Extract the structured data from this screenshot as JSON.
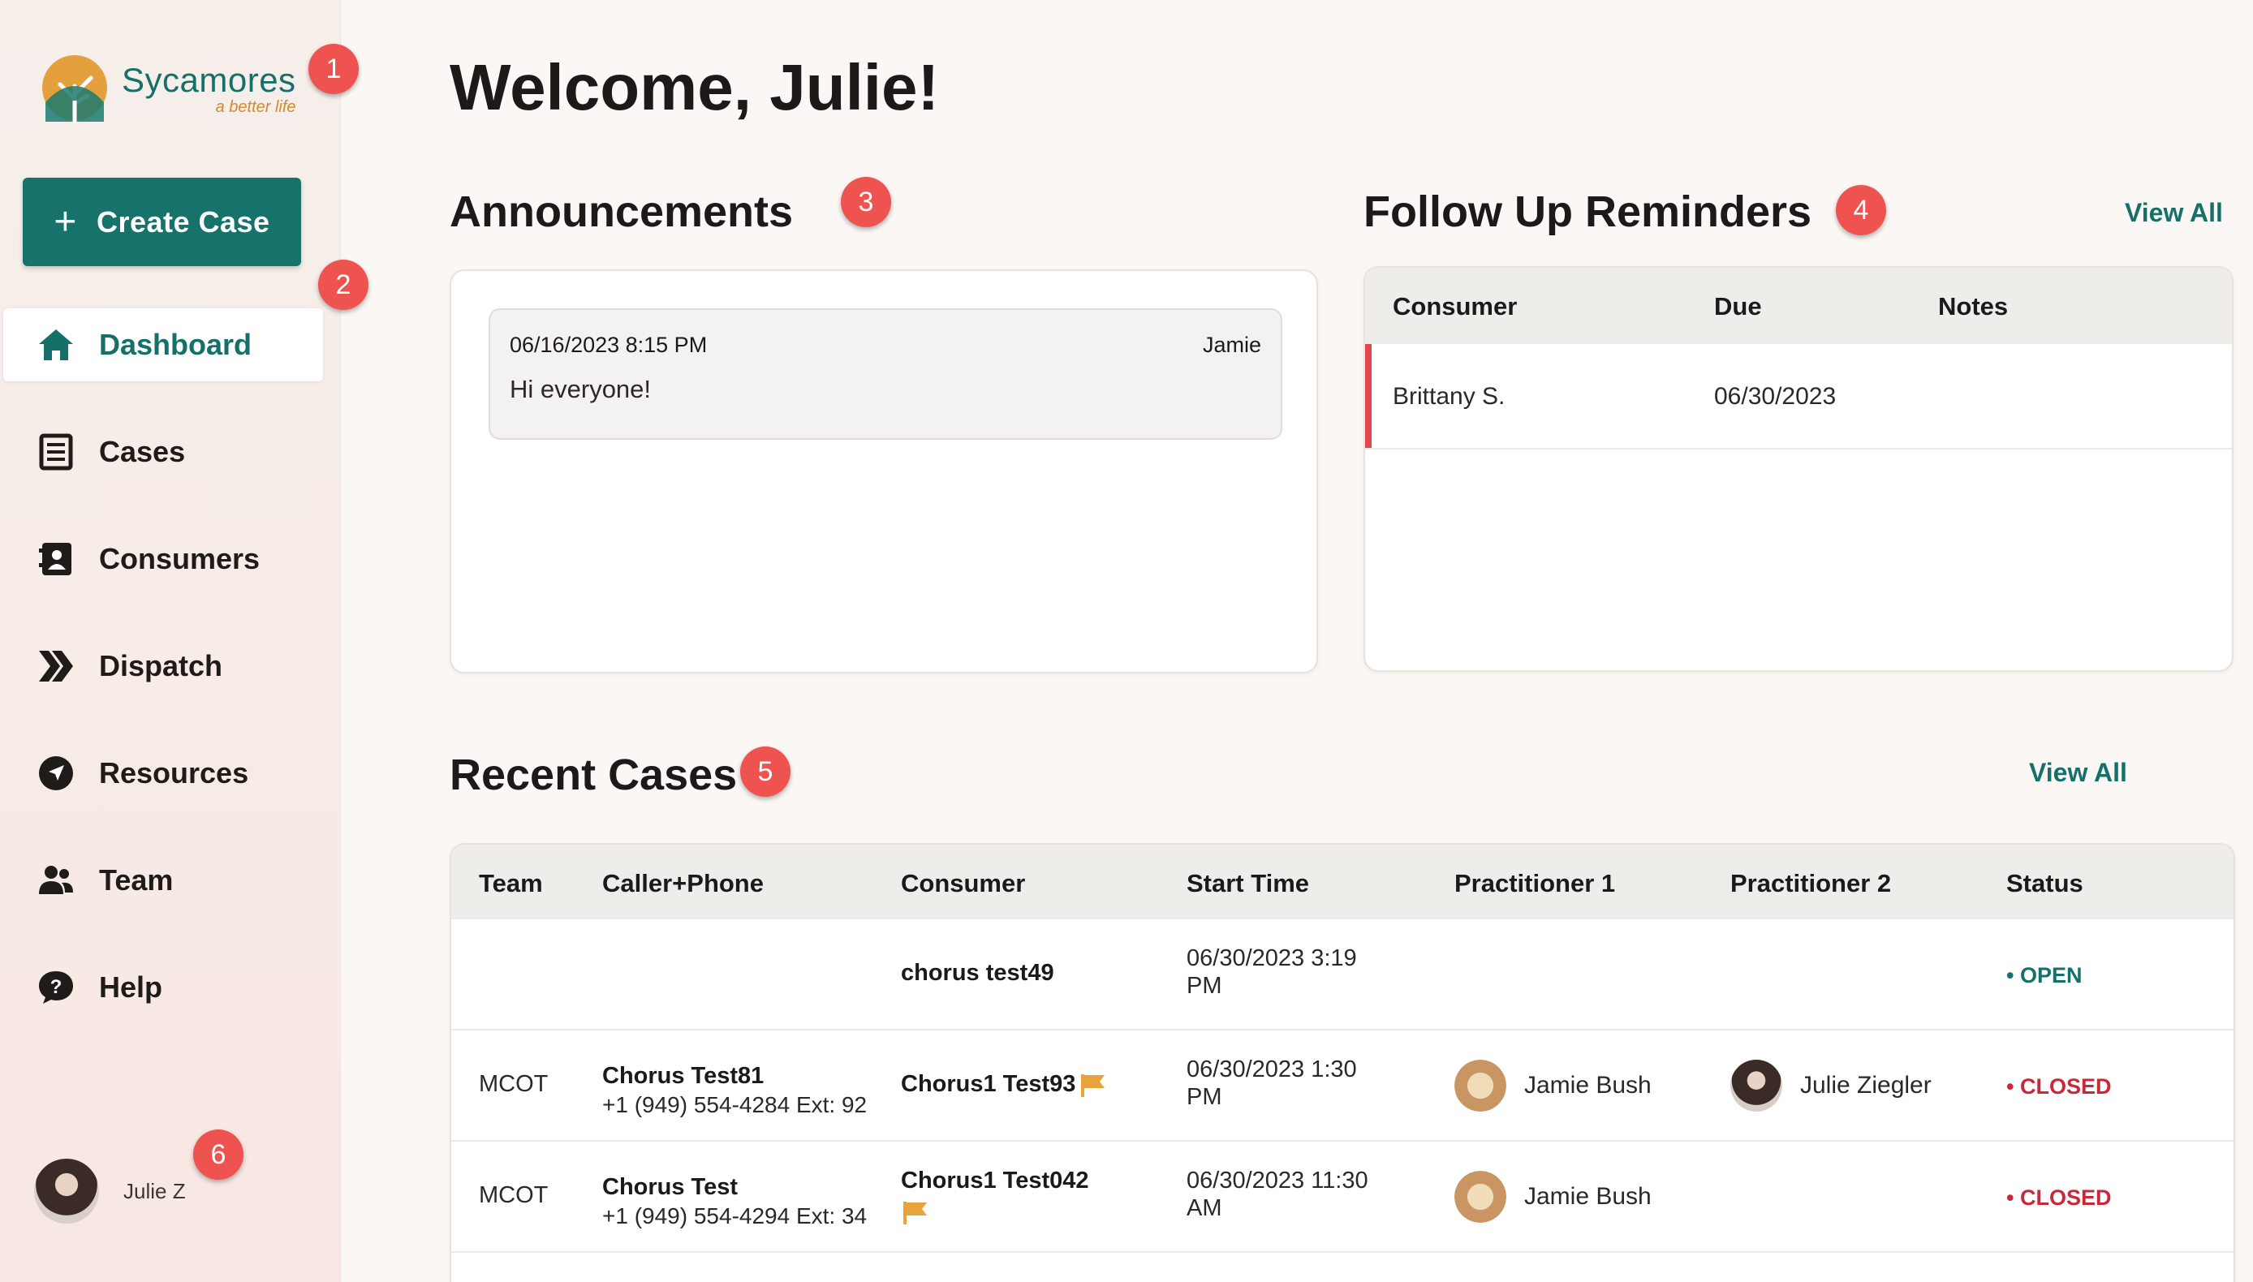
{
  "app": {
    "name": "Sycamores",
    "tagline": "a better life"
  },
  "sidebar": {
    "create_label": "Create Case",
    "items": [
      {
        "label": "Dashboard",
        "icon": "home-icon",
        "active": true
      },
      {
        "label": "Cases",
        "icon": "document-list-icon"
      },
      {
        "label": "Consumers",
        "icon": "contact-card-icon"
      },
      {
        "label": "Dispatch",
        "icon": "double-chevron-icon"
      },
      {
        "label": "Resources",
        "icon": "location-arrow-icon"
      },
      {
        "label": "Team",
        "icon": "users-icon"
      },
      {
        "label": "Help",
        "icon": "help-bubble-icon"
      }
    ],
    "user": {
      "name": "Julie Z"
    }
  },
  "badges": [
    "1",
    "2",
    "3",
    "4",
    "5",
    "6"
  ],
  "main": {
    "welcome": "Welcome, Julie!",
    "announcements": {
      "title": "Announcements",
      "items": [
        {
          "date": "06/16/2023 8:15 PM",
          "author": "Jamie",
          "text": "Hi everyone!"
        }
      ]
    },
    "reminders": {
      "title": "Follow Up Reminders",
      "view_all": "View All",
      "columns": [
        "Consumer",
        "Due",
        "Notes"
      ],
      "rows": [
        {
          "consumer": "Brittany S.",
          "due": "06/30/2023",
          "notes": ""
        }
      ]
    },
    "recent_cases": {
      "title": "Recent Cases",
      "view_all": "View All",
      "columns": [
        "Team",
        "Caller+Phone",
        "Consumer",
        "Start Time",
        "Practitioner 1",
        "Practitioner 2",
        "Status"
      ],
      "rows": [
        {
          "team": "",
          "caller": "",
          "phone": "",
          "consumer": "chorus test49",
          "start_line1": "06/30/2023 3:19",
          "start_line2": "PM",
          "prac1": "",
          "prac2": "",
          "status": "OPEN"
        },
        {
          "team": "MCOT",
          "caller": "Chorus Test81",
          "phone": "+1 (949) 554-4284 Ext: 92",
          "consumer": "Chorus1 Test93",
          "start_line1": "06/30/2023 1:30",
          "start_line2": "PM",
          "prac1": "Jamie Bush",
          "prac2": "Julie Ziegler",
          "status": "CLOSED"
        },
        {
          "team": "MCOT",
          "caller": "Chorus Test",
          "phone": "+1 (949) 554-4294 Ext: 34",
          "consumer": "Chorus1 Test042",
          "start_line1": "06/30/2023 11:30",
          "start_line2": "AM",
          "prac1": "Jamie Bush",
          "prac2": "",
          "status": "CLOSED"
        }
      ]
    }
  },
  "colors": {
    "brand_teal": "#17726c",
    "brand_orange": "#d28a2a",
    "badge_red": "#ef5350",
    "closed_red": "#c8283a",
    "flag_orange": "#e8a33a"
  }
}
